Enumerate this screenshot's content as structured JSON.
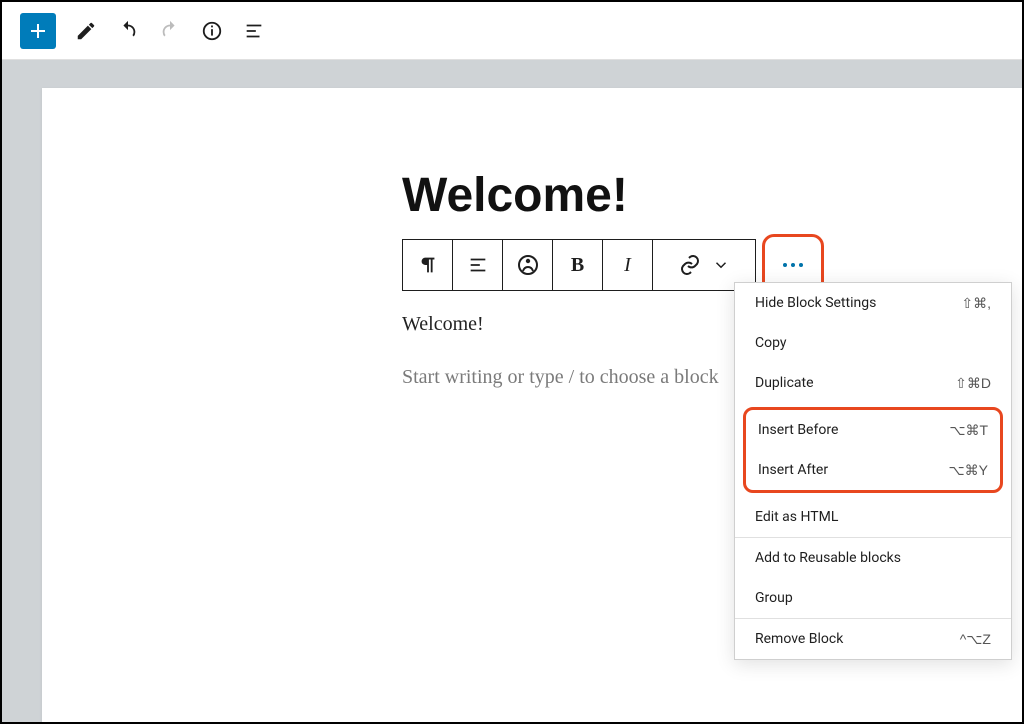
{
  "top_toolbar": {
    "spacer": ""
  },
  "editor": {
    "title": "Welcome!",
    "paragraph": "Welcome!",
    "placeholder": "Start writing or type / to choose a block"
  },
  "block_toolbar": {
    "bold": "B",
    "italic": "I"
  },
  "dropdown": {
    "hide_settings": {
      "label": "Hide Block Settings",
      "shortcut": "⇧⌘,"
    },
    "copy": {
      "label": "Copy",
      "shortcut": ""
    },
    "duplicate": {
      "label": "Duplicate",
      "shortcut": "⇧⌘D"
    },
    "insert_before": {
      "label": "Insert Before",
      "shortcut": "⌥⌘T"
    },
    "insert_after": {
      "label": "Insert After",
      "shortcut": "⌥⌘Y"
    },
    "edit_html": {
      "label": "Edit as HTML",
      "shortcut": ""
    },
    "add_reusable": {
      "label": "Add to Reusable blocks",
      "shortcut": ""
    },
    "group": {
      "label": "Group",
      "shortcut": ""
    },
    "remove": {
      "label": "Remove Block",
      "shortcut": "^⌥Z"
    }
  }
}
